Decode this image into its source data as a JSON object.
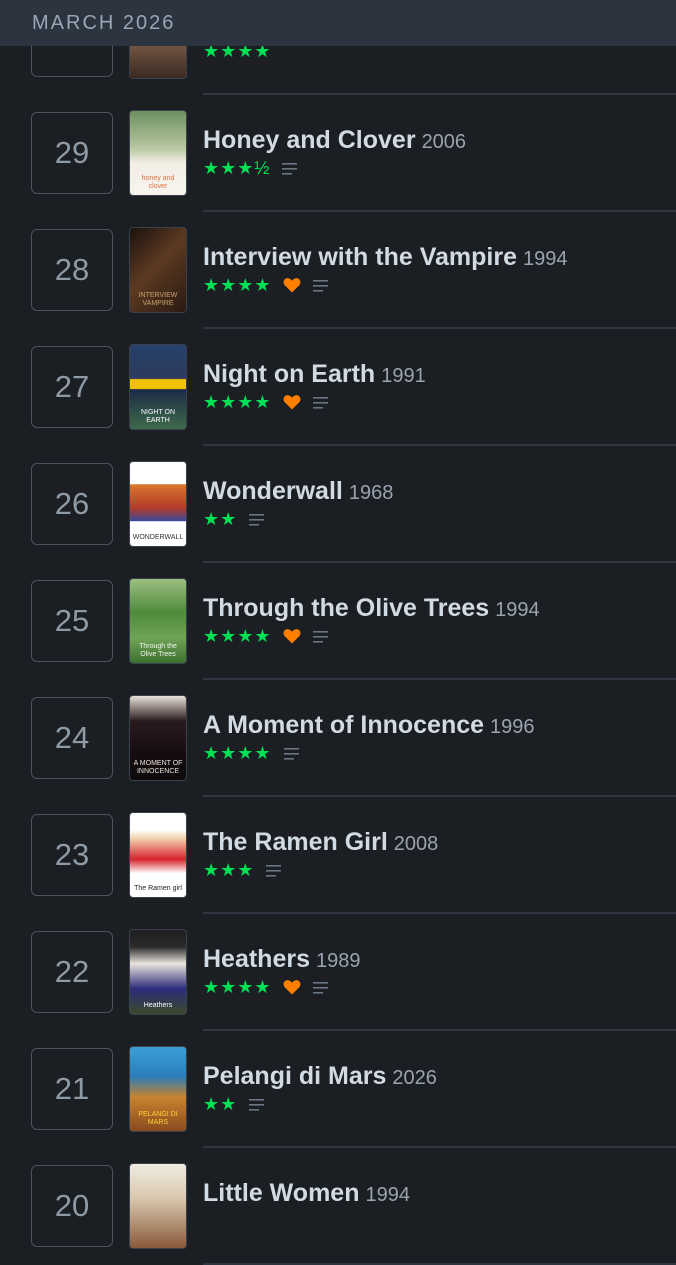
{
  "header": {
    "month": "MARCH 2026"
  },
  "colors": {
    "stars": "#00e054",
    "heart": "#ff8000",
    "background": "#1b1f23"
  },
  "icons": {
    "heart": "heart-icon",
    "review": "review-lines-icon"
  },
  "entries": [
    {
      "day": "",
      "title": "",
      "year": "",
      "stars": "★★★★",
      "liked": false,
      "review": false,
      "poster": {
        "text": "",
        "bg": "linear-gradient(#d8cfc2,#7a5c45 55%,#3b2a22)",
        "color": "#222"
      }
    },
    {
      "day": "29",
      "title": "Honey and Clover",
      "year": "2006",
      "stars": "★★★½",
      "liked": false,
      "review": true,
      "poster": {
        "text": "honey and clover",
        "bg": "linear-gradient(#6e8f5f,#b9c9a3 45%,#f2eee6 62%,#f7f4ee)",
        "color": "#e0713d"
      }
    },
    {
      "day": "28",
      "title": "Interview with the Vampire",
      "year": "1994",
      "stars": "★★★★",
      "liked": true,
      "review": true,
      "poster": {
        "text": "INTERVIEW VAMPIRE",
        "bg": "linear-gradient(135deg,#1a120e,#5c3a22 45%,#2a1a12)",
        "color": "#c7a26a"
      }
    },
    {
      "day": "27",
      "title": "Night on Earth",
      "year": "1991",
      "stars": "★★★★",
      "liked": true,
      "review": true,
      "poster": {
        "text": "NIGHT ON EARTH",
        "bg": "linear-gradient(#27406b,#2d3a5c 40%,#f2c200 41%,#f2c200 52%,#1b2b45 53%,#3f6a4a)",
        "color": "#ffffff"
      }
    },
    {
      "day": "26",
      "title": "Wonderwall",
      "year": "1968",
      "stars": "★★",
      "liked": false,
      "review": true,
      "poster": {
        "text": "WONDERWALL",
        "bg": "linear-gradient(#ffffff,#ffffff 26%,#d9762c 27%,#b23a2a 55%,#3a4a9a 70%,#ffffff 71%)",
        "color": "#333"
      }
    },
    {
      "day": "25",
      "title": "Through the Olive Trees",
      "year": "1994",
      "stars": "★★★★",
      "liked": true,
      "review": true,
      "poster": {
        "text": "Through the Olive Trees",
        "bg": "linear-gradient(#9bbf80,#4f8a3c 40%,#6fa456 70%,#3d7030)",
        "color": "#f4f4f4"
      }
    },
    {
      "day": "24",
      "title": "A Moment of Innocence",
      "year": "1996",
      "stars": "★★★★",
      "liked": false,
      "review": true,
      "poster": {
        "text": "A MOMENT OF INNOCENCE",
        "bg": "linear-gradient(#e8e2d8,#2a1a1e 30%,#140c10 70%,#0e0a0c)",
        "color": "#e8e2d8"
      }
    },
    {
      "day": "23",
      "title": "The Ramen Girl",
      "year": "2008",
      "stars": "★★★",
      "liked": false,
      "review": true,
      "poster": {
        "text": "The Ramen girl",
        "bg": "linear-gradient(#ffffff,#ffffff 20%,#f2d3b0 30%,#d9232e 55%,#ffffff 72%)",
        "color": "#222"
      }
    },
    {
      "day": "22",
      "title": "Heathers",
      "year": "1989",
      "stars": "★★★★",
      "liked": true,
      "review": true,
      "poster": {
        "text": "Heathers",
        "bg": "linear-gradient(#1e1e1e,#2a2a2a 20%,#e9e4dc 40%,#2c2c7a 70%,#3a4a2a)",
        "color": "#ffffff"
      }
    },
    {
      "day": "21",
      "title": "Pelangi di Mars",
      "year": "2026",
      "stars": "★★",
      "liked": false,
      "review": true,
      "poster": {
        "text": "PELANGI DI MARS",
        "bg": "linear-gradient(#3aa0d8,#2b7db8 35%,#c9822e 60%,#8a4a1e)",
        "color": "#ffd23a"
      }
    },
    {
      "day": "20",
      "title": "Little Women",
      "year": "1994",
      "stars": "",
      "liked": false,
      "review": false,
      "poster": {
        "text": "",
        "bg": "linear-gradient(#f0ebe0,#d9c8b0 40%,#8a5a3a)",
        "color": "#222"
      }
    }
  ]
}
